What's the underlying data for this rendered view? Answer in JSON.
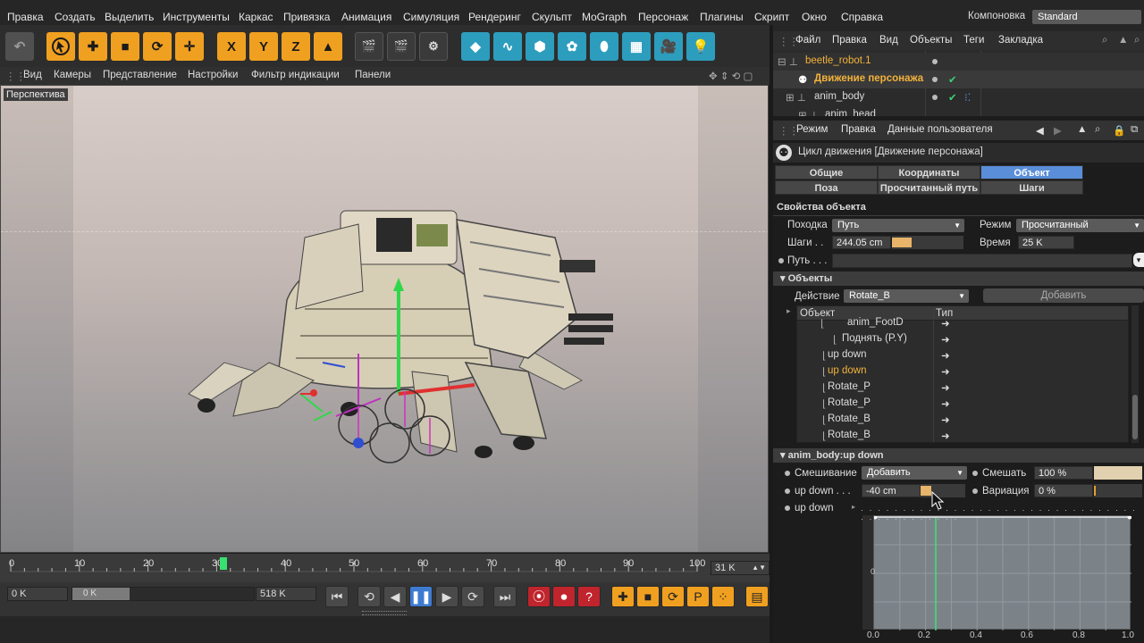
{
  "menu": [
    "Правка",
    "Создать",
    "Выделить",
    "Инструменты",
    "Каркас",
    "Привязка",
    "Анимация",
    "Симуляция",
    "Рендеринг",
    "Скульпт",
    "MoGraph",
    "Персонаж",
    "Плагины",
    "Скрипт",
    "Окно",
    "Справка"
  ],
  "layout": {
    "label": "Компоновка",
    "value": "Standard"
  },
  "toolbar_axes": [
    "X",
    "Y",
    "Z"
  ],
  "view_menu": [
    "Вид",
    "Камеры",
    "Представление",
    "Настройки",
    "Фильтр индикации",
    "Панели"
  ],
  "viewport_label": "Перспектива",
  "timeline": {
    "ticks": [
      "0",
      "10",
      "20",
      "30",
      "40",
      "50",
      "60",
      "70",
      "80",
      "90",
      "100"
    ],
    "current_frame_field": "31 K",
    "playhead_frame": 31
  },
  "transport": {
    "start": "0 K",
    "range_slider": "0 K",
    "end": "518 K"
  },
  "object_manager": {
    "menu": [
      "Файл",
      "Правка",
      "Вид",
      "Объекты",
      "Теги",
      "Закладка"
    ],
    "tree": [
      "beetle_robot.1",
      "Движение персонажа",
      "anim_body",
      "anim_head"
    ]
  },
  "attributes": {
    "menu": [
      "Режим",
      "Правка",
      "Данные пользователя"
    ],
    "title": "Цикл движения [Движение персонажа]",
    "tabs_row1": [
      "Общие",
      "Координаты",
      "Объект"
    ],
    "tabs_row2": [
      "Поза",
      "Просчитанный путь",
      "Шаги"
    ],
    "active_tab": "Объект",
    "section_props": "Свойства объекта",
    "walk_label": "Походка",
    "walk_value": "Путь",
    "mode_label": "Режим",
    "mode_value": "Просчитанный",
    "steps_label": "Шаги . .",
    "steps_value": "244.05 cm",
    "time_label": "Время",
    "time_value": "25 K",
    "path_label": "Путь . . .",
    "section_objects": "Объекты",
    "action_label": "Действие",
    "action_value": "Rotate_B",
    "add_button": "Добавить",
    "list_headers": [
      "Объект",
      "Тип"
    ],
    "list_items": [
      "anim_FootD",
      "Поднять (P.Y)",
      "up down",
      "up down",
      "Rotate_P",
      "Rotate_P",
      "Rotate_B",
      "Rotate_B"
    ],
    "selected_item": "up down",
    "section_anim": "anim_body:up down",
    "blend_label": "Смешивание",
    "blend_value": "Добавить",
    "mix_label": "Смешать",
    "mix_value": "100 %",
    "updown_label": "up down . . .",
    "updown_value": "-40 cm",
    "variation_label": "Вариация",
    "variation_value": "0 %",
    "curve_label": "up down",
    "graph_y_label": "0",
    "graph_x_ticks": [
      "0.0",
      "0.2",
      "0.4",
      "0.6",
      "0.8",
      "1.0"
    ]
  },
  "colors": {
    "accent_orange": "#f0a020",
    "accent_blue": "#5a8ed8",
    "highlight_text": "#f3b23a"
  }
}
